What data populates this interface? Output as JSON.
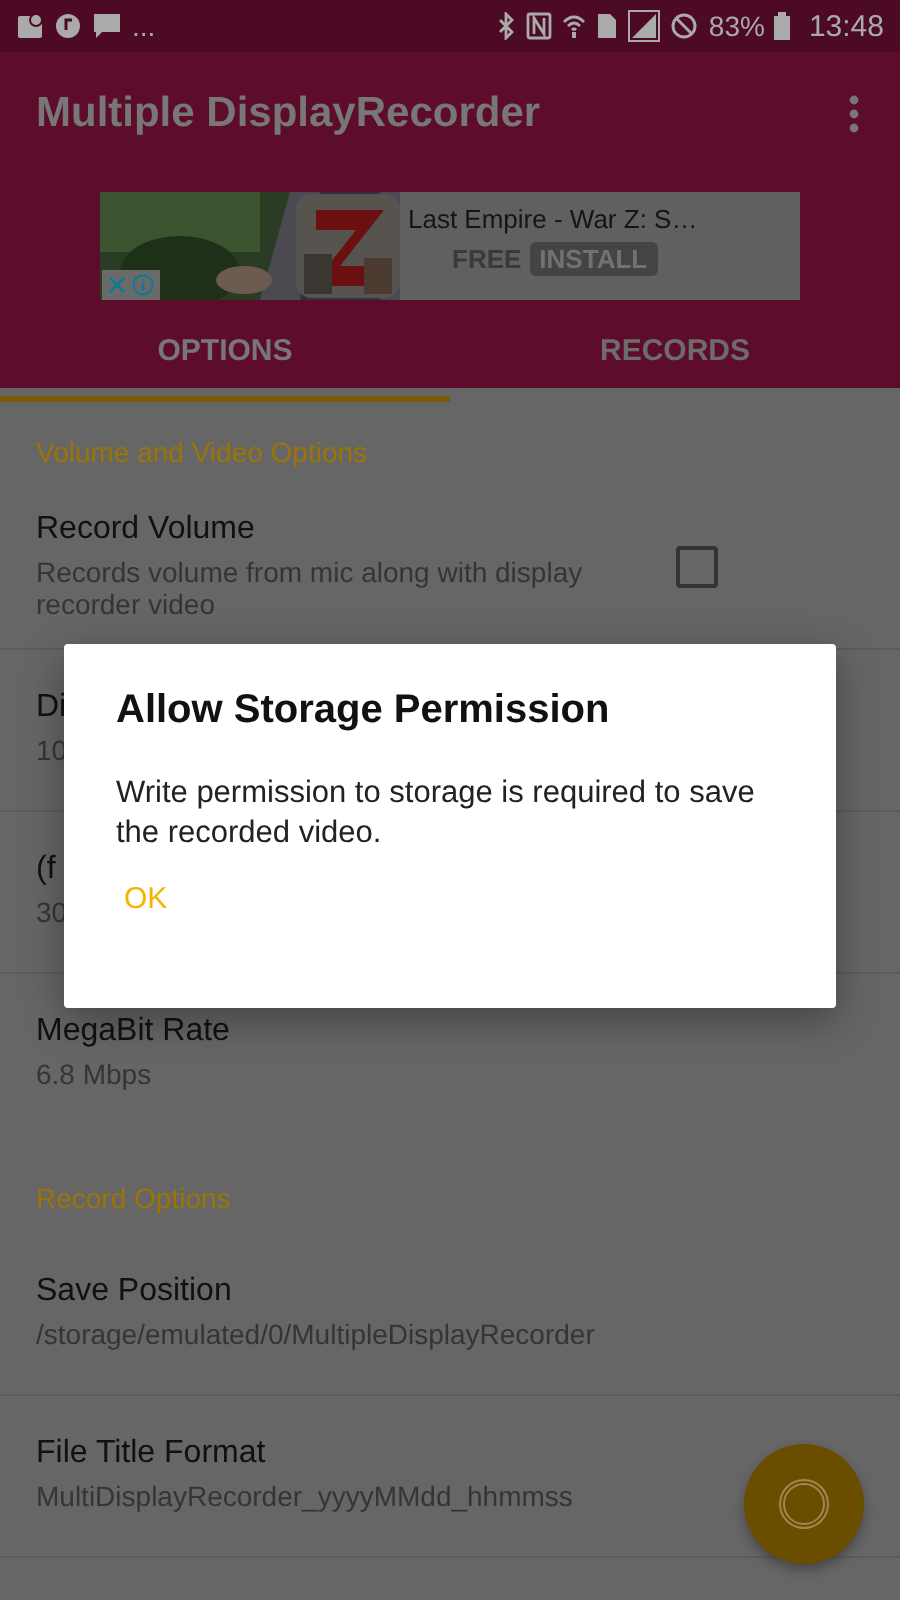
{
  "status_bar": {
    "notification_more": "...",
    "battery_percent": "83%",
    "time": "13:48"
  },
  "app_bar": {
    "title": "Multiple DisplayRecorder"
  },
  "ad": {
    "title": "Last Empire - War Z: S…",
    "price": "FREE",
    "install": "INSTALL"
  },
  "tabs": [
    {
      "label": "OPTIONS",
      "selected": true
    },
    {
      "label": "RECORDS",
      "selected": false
    }
  ],
  "sections": [
    {
      "header": "Volume and Video Options",
      "items": [
        {
          "kind": "checkbox",
          "title": "Record Volume",
          "summary": "Records volume from mic along with display recorder video",
          "checked": false
        },
        {
          "kind": "text",
          "title": "Di",
          "summary": "10"
        },
        {
          "kind": "text",
          "title": "(f",
          "summary": "30"
        },
        {
          "kind": "text",
          "title": "MegaBit Rate",
          "summary": "6.8 Mbps"
        }
      ]
    },
    {
      "header": "Record Options",
      "items": [
        {
          "kind": "text",
          "title": "Save Position",
          "summary": "/storage/emulated/0/MultipleDisplayRecorder"
        },
        {
          "kind": "text",
          "title": "File Title Format",
          "summary": "MultiDisplayRecorder_yyyyMMdd_hhmmss"
        }
      ]
    }
  ],
  "dialog": {
    "title": "Allow Storage Permission",
    "message": "Write permission to storage is required to save the recorded video.",
    "button": "OK"
  }
}
